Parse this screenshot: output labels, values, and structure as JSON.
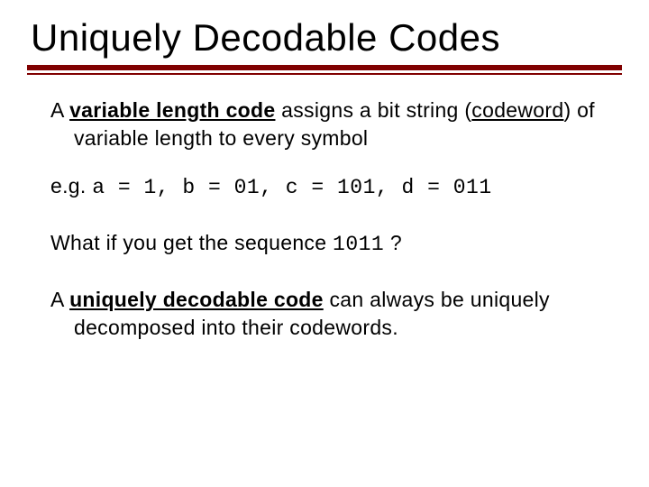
{
  "title": "Uniquely Decodable Codes",
  "para1": {
    "lead": "A ",
    "vlc": "variable length code",
    "mid": " assigns a bit string (",
    "codeword": "codeword",
    "tail": ") of variable length to every symbol"
  },
  "para2": {
    "lead": "e.g. ",
    "code": "a = 1, b = 01, c = 101, d = 011"
  },
  "para3": {
    "lead": "What if you get the sequence ",
    "code": "1011",
    "tail": " ?"
  },
  "para4": {
    "lead": "A ",
    "udc": "uniquely decodable code",
    "tail": " can always be uniquely decomposed into their codewords."
  }
}
